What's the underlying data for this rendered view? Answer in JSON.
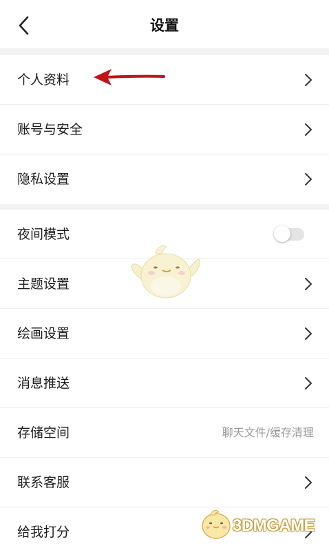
{
  "header": {
    "title": "设置",
    "back_icon": "chevron-left-icon"
  },
  "group1": {
    "items": [
      {
        "label": "个人资料"
      },
      {
        "label": "账号与安全"
      },
      {
        "label": "隐私设置"
      }
    ]
  },
  "group2": {
    "items": [
      {
        "label": "夜间模式",
        "toggle_on": false
      },
      {
        "label": "主题设置"
      },
      {
        "label": "绘画设置"
      },
      {
        "label": "消息推送"
      },
      {
        "label": "存储空间",
        "value": "聊天文件/缓存清理"
      },
      {
        "label": "联系客服"
      },
      {
        "label": "给我打分"
      }
    ]
  },
  "annotation": {
    "arrow_color": "#c0141b"
  },
  "watermark": {
    "text": "3DMGAME"
  },
  "colors": {
    "background": "#f2f2f2",
    "surface": "#ffffff",
    "divider": "#ececec"
  }
}
